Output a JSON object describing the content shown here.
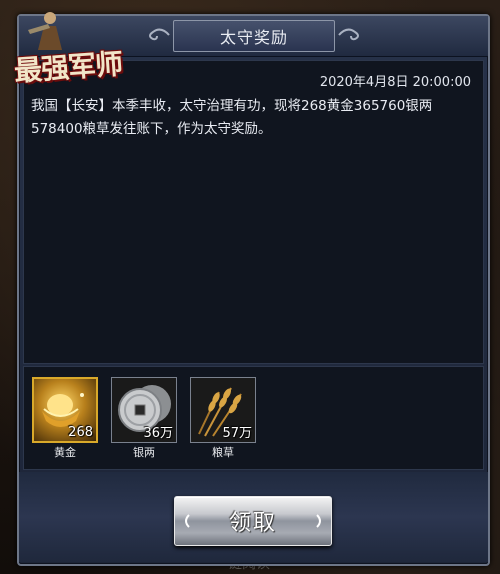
{
  "logo": {
    "text": "最强军师"
  },
  "dialog": {
    "title": "太守奖励",
    "timestamp": "2020年4月8日 20:00:00",
    "message": "我国【长安】本季丰收，太守治理有功，现将268黄金365760银两578400粮草发往账下，作为太守奖励。"
  },
  "rewards": [
    {
      "name": "黄金",
      "count": "268",
      "icon": "gold-ingot-icon"
    },
    {
      "name": "银两",
      "count": "36万",
      "icon": "silver-coin-icon"
    },
    {
      "name": "粮草",
      "count": "57万",
      "icon": "wheat-icon"
    }
  ],
  "claim_label": "领取",
  "below_text": "链阅读",
  "colors": {
    "gold_border": "#d9a92a",
    "panel_bg": "#10151f",
    "frame": "#27324a"
  }
}
